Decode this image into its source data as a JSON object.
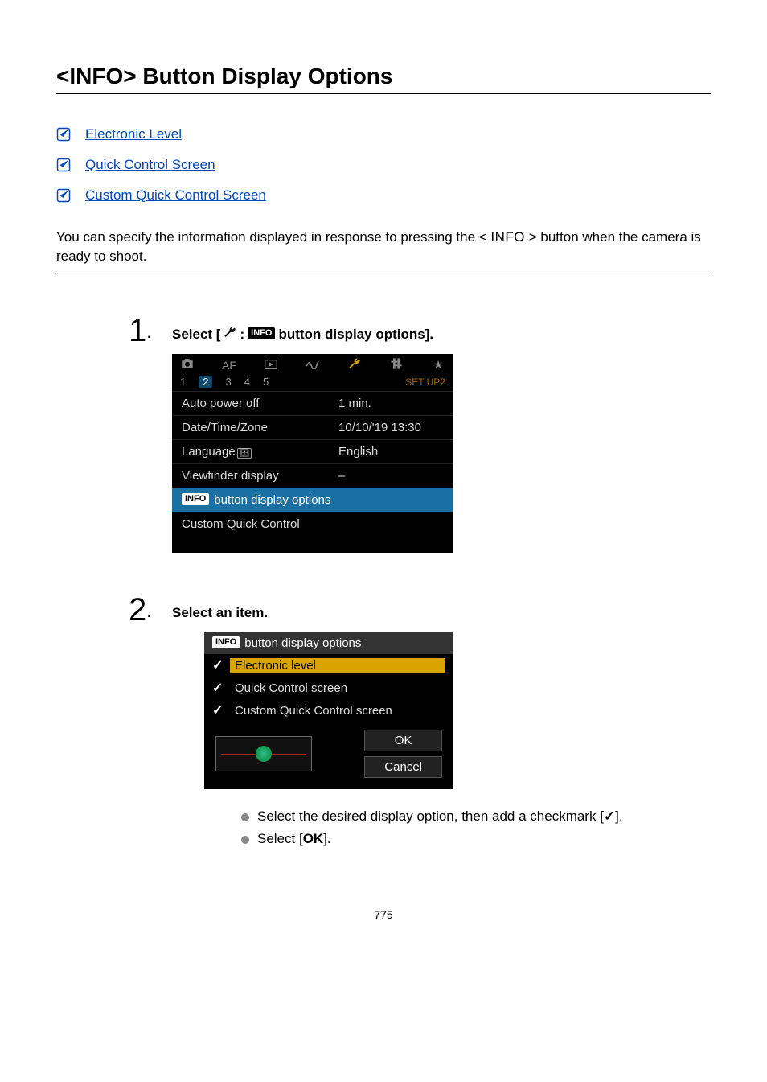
{
  "title": "<INFO> Button Display Options",
  "toc": [
    {
      "label": "Electronic Level"
    },
    {
      "label": "Quick Control Screen"
    },
    {
      "label": "Custom Quick Control Screen"
    }
  ],
  "intro_pre": "You can specify the information displayed in response to pressing the < ",
  "intro_info": "INFO",
  "intro_post": " > button when the camera is ready to shoot.",
  "steps": {
    "one": {
      "num": "1",
      "heading_pre": "Select [",
      "heading_mid": ": ",
      "heading_post": " button display options].",
      "info_badge": "INFO",
      "screen": {
        "sub_tabs": [
          "1",
          "2",
          "3",
          "4",
          "5"
        ],
        "sub_label": "SET UP2",
        "rows": [
          {
            "label": "Auto power off",
            "value": "1 min."
          },
          {
            "label": "Date/Time/Zone",
            "value": "10/10/'19 13:30"
          },
          {
            "label": "Language",
            "value": "English",
            "has_lang_icon": true
          },
          {
            "label": "Viewfinder display",
            "value": "–"
          }
        ],
        "selected": "button display options",
        "after_selected": "Custom Quick Control"
      }
    },
    "two": {
      "num": "2",
      "heading": "Select an item.",
      "title": "button display options",
      "items": [
        {
          "checked": true,
          "label": "Electronic level",
          "selected": true
        },
        {
          "checked": true,
          "label": "Quick Control screen"
        },
        {
          "checked": true,
          "label": "Custom Quick Control screen"
        }
      ],
      "ok": "OK",
      "cancel": "Cancel",
      "bullets": {
        "b1_pre": "Select the desired display option, then add a checkmark [",
        "b1_check": "✓",
        "b1_post": "].",
        "b2_pre": "Select [",
        "b2_bold": "OK",
        "b2_post": "]."
      }
    }
  },
  "page_number": "775"
}
